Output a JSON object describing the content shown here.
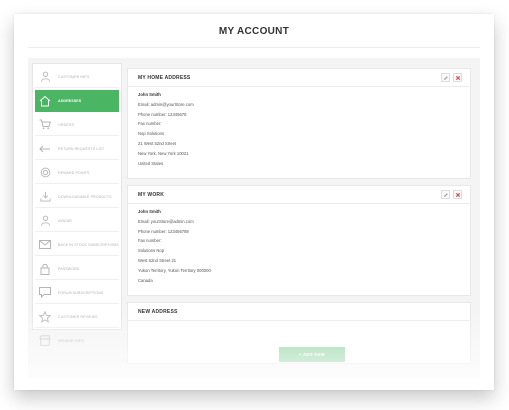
{
  "page": {
    "title": "MY ACCOUNT"
  },
  "colors": {
    "accent": "#4ab563",
    "add_button": "#8fd3a0",
    "delete": "#d9534f"
  },
  "sidebar": {
    "items": [
      {
        "label": "Customer info",
        "icon": "user-icon",
        "active": false
      },
      {
        "label": "Addresses",
        "icon": "home-icon",
        "active": true
      },
      {
        "label": "Orders",
        "icon": "cart-icon",
        "active": false
      },
      {
        "label": "Return requests list",
        "icon": "return-arrow-icon",
        "active": false
      },
      {
        "label": "Reward points",
        "icon": "badge-icon",
        "active": false
      },
      {
        "label": "Downloadable products",
        "icon": "download-icon",
        "active": false
      },
      {
        "label": "Avatar",
        "icon": "avatar-icon",
        "active": false
      },
      {
        "label": "Back in stock subscriptions",
        "icon": "mail-icon",
        "active": false
      },
      {
        "label": "Password",
        "icon": "lock-icon",
        "active": false
      },
      {
        "label": "Forum subscriptions",
        "icon": "chat-icon",
        "active": false
      },
      {
        "label": "Customer reviews",
        "icon": "star-icon",
        "active": false
      },
      {
        "label": "Vendor info",
        "icon": "store-icon",
        "active": false
      }
    ]
  },
  "addresses": [
    {
      "title": "MY HOME ADDRESS",
      "name": "John Smith",
      "email": "Email: admin@yourStore.com",
      "phone": "Phone number: 12345678",
      "fax": "Fax number:",
      "company": "Nop Solutions",
      "address1": "21 West 52nd Street",
      "city": "New York, New York 10021",
      "country": "United States"
    },
    {
      "title": "MY WORK",
      "name": "John Smith",
      "email": "Email: yourStore@admin.com",
      "phone": "Phone number: 123456789",
      "fax": "Fax number:",
      "company": "Solutions Nop",
      "address1": "West 52nd Street 21",
      "city": "Yukon Territory, Yukon Territory 000000",
      "country": "Canada"
    }
  ],
  "new_address": {
    "title": "NEW ADDRESS",
    "button_label": "+ ADD NEW"
  }
}
